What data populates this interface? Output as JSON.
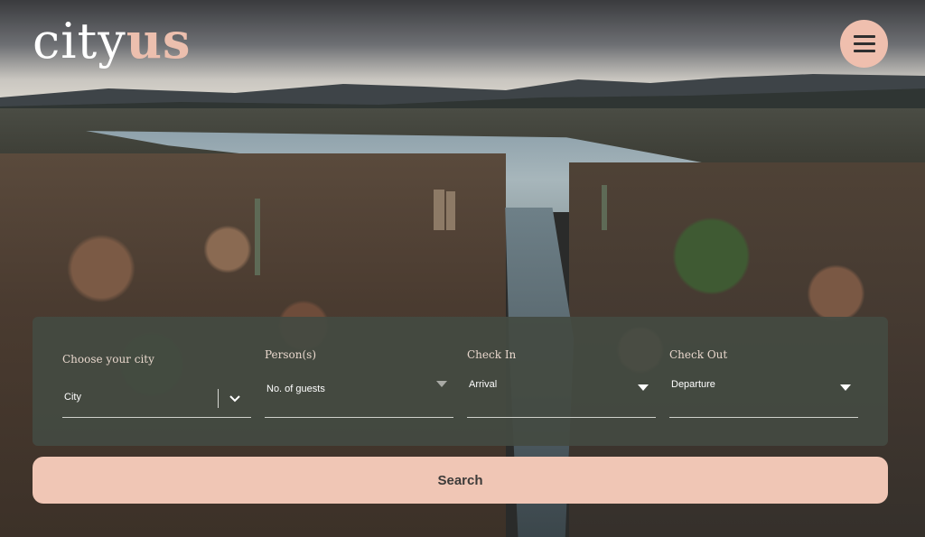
{
  "brand": {
    "logo_part1": "city",
    "logo_part2": "us"
  },
  "header": {
    "menu_icon": "hamburger-menu-icon"
  },
  "booking": {
    "city": {
      "label": "Choose your city",
      "value": "City"
    },
    "persons": {
      "label": "Person(s)",
      "value": "No. of guests"
    },
    "check_in": {
      "label": "Check In",
      "value": "Arrival"
    },
    "check_out": {
      "label": "Check Out",
      "value": "Departure"
    }
  },
  "search": {
    "label": "Search"
  },
  "colors": {
    "accent": "#efbfae",
    "panel": "#444a42",
    "button": "#f0c6b5"
  }
}
